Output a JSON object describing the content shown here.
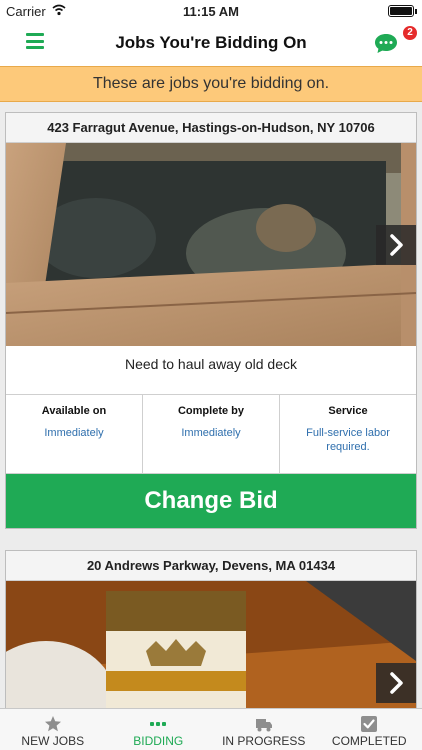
{
  "status_bar": {
    "carrier": "Carrier",
    "time": "11:15 AM"
  },
  "header": {
    "title": "Jobs You're Bidding On",
    "chat_badge": "2"
  },
  "notice": "These are jobs you're bidding on.",
  "jobs": [
    {
      "address": "423 Farragut Avenue, Hastings-on-Hudson, NY 10706",
      "description": "Need to haul away old deck",
      "available_label": "Available on",
      "available_value": "Immediately",
      "complete_label": "Complete by",
      "complete_value": "Immediately",
      "service_label": "Service",
      "service_value": "Full-service labor required.",
      "button": "Change Bid"
    },
    {
      "address": "20 Andrews Parkway, Devens, MA 01434"
    }
  ],
  "tabs": [
    {
      "label": "NEW JOBS",
      "icon": "star-icon"
    },
    {
      "label": "BIDDING",
      "icon": "dots-icon"
    },
    {
      "label": "IN PROGRESS",
      "icon": "truck-icon"
    },
    {
      "label": "COMPLETED",
      "icon": "checkbox-icon"
    }
  ],
  "colors": {
    "accent": "#1faa55",
    "notice": "#fdc97a",
    "link": "#2f6fad",
    "badge": "#e52b2b"
  }
}
